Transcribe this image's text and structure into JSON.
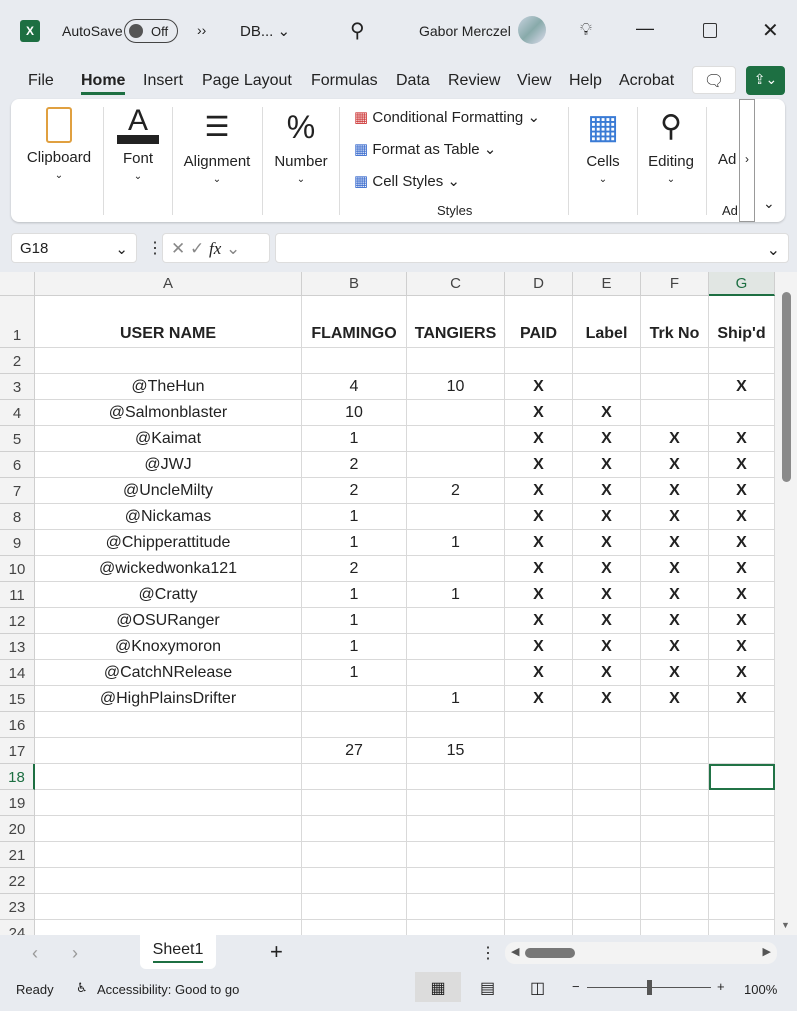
{
  "titlebar": {
    "app_icon": "excel-icon",
    "autosave_label": "AutoSave",
    "autosave_state": "Off",
    "filename": "DB...",
    "user": "Gabor Merczel"
  },
  "menu": [
    "File",
    "Home",
    "Insert",
    "Page Layout",
    "Formulas",
    "Data",
    "Review",
    "View",
    "Help",
    "Acrobat"
  ],
  "active_tab": "Home",
  "ribbon": {
    "clipboard": "Clipboard",
    "font": "Font",
    "alignment": "Alignment",
    "number": "Number",
    "conditional_formatting": "Conditional Formatting",
    "format_as_table": "Format as Table",
    "cell_styles": "Cell Styles",
    "styles": "Styles",
    "cells": "Cells",
    "editing": "Editing",
    "addins": "Ad",
    "addins_group": "Ad"
  },
  "formula_bar": {
    "name_box": "G18",
    "fx": "fx",
    "value": ""
  },
  "columns": [
    "A",
    "B",
    "C",
    "D",
    "E",
    "F",
    "G"
  ],
  "selected_cell": "G18",
  "rows": [
    [
      "USER NAME",
      "FLAMINGO",
      "TANGIERS",
      "PAID",
      "Label",
      "Trk No",
      "Ship'd"
    ],
    [
      "",
      "",
      "",
      "",
      "",
      "",
      ""
    ],
    [
      "@TheHun",
      "4",
      "10",
      "X",
      "",
      "",
      "X"
    ],
    [
      "@Salmonblaster",
      "10",
      "",
      "X",
      "X",
      "",
      ""
    ],
    [
      "@Kaimat",
      "1",
      "",
      "X",
      "X",
      "X",
      "X"
    ],
    [
      "@JWJ",
      "2",
      "",
      "X",
      "X",
      "X",
      "X"
    ],
    [
      "@UncleMilty",
      "2",
      "2",
      "X",
      "X",
      "X",
      "X"
    ],
    [
      "@Nickamas",
      "1",
      "",
      "X",
      "X",
      "X",
      "X"
    ],
    [
      "@Chipperattitude",
      "1",
      "1",
      "X",
      "X",
      "X",
      "X"
    ],
    [
      "@wickedwonka121",
      "2",
      "",
      "X",
      "X",
      "X",
      "X"
    ],
    [
      "@Cratty",
      "1",
      "1",
      "X",
      "X",
      "X",
      "X"
    ],
    [
      "@OSURanger",
      "1",
      "",
      "X",
      "X",
      "X",
      "X"
    ],
    [
      "@Knoxymoron",
      "1",
      "",
      "X",
      "X",
      "X",
      "X"
    ],
    [
      "@CatchNRelease",
      "1",
      "",
      "X",
      "X",
      "X",
      "X"
    ],
    [
      "@HighPlainsDrifter",
      "",
      "1",
      "X",
      "X",
      "X",
      "X"
    ],
    [
      "",
      "",
      "",
      "",
      "",
      "",
      ""
    ],
    [
      "",
      "27",
      "15",
      "",
      "",
      "",
      ""
    ],
    [
      "",
      "",
      "",
      "",
      "",
      "",
      ""
    ],
    [
      "",
      "",
      "",
      "",
      "",
      "",
      ""
    ],
    [
      "",
      "",
      "",
      "",
      "",
      "",
      ""
    ],
    [
      "",
      "",
      "",
      "",
      "",
      "",
      ""
    ],
    [
      "",
      "",
      "",
      "",
      "",
      "",
      ""
    ],
    [
      "",
      "",
      "",
      "",
      "",
      "",
      ""
    ],
    [
      "",
      "",
      "",
      "",
      "",
      "",
      ""
    ]
  ],
  "sheet_tabs": [
    "Sheet1"
  ],
  "status": {
    "ready": "Ready",
    "accessibility": "Accessibility: Good to go",
    "zoom": "100%",
    "zoom_level_percent": 100
  },
  "colors": {
    "accent": "#1d6f42",
    "selection": "#217346"
  }
}
